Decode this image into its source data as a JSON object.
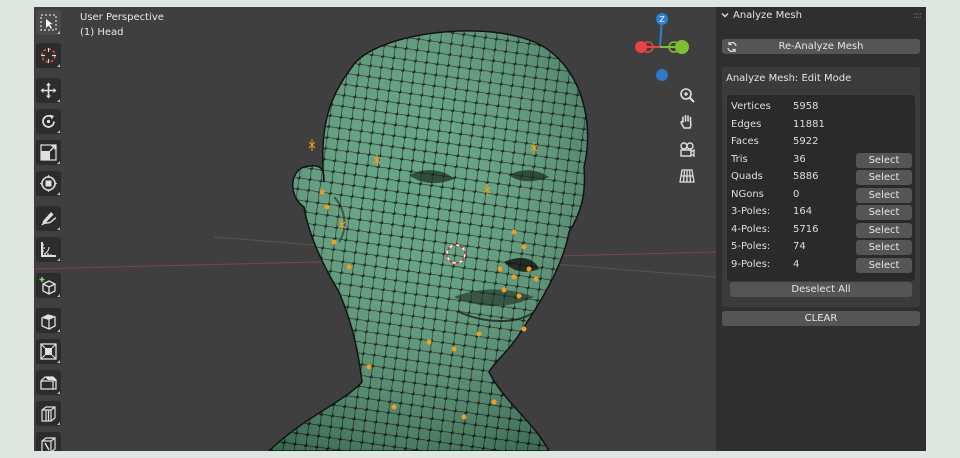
{
  "viewport": {
    "title": "User Perspective",
    "subtitle": "(1) Head",
    "gizmo": {
      "z_label": "Z",
      "y_label": "Y",
      "x_label": "X"
    }
  },
  "toolbar": {
    "tools": [
      {
        "icon": "select-box-icon",
        "active": true
      },
      {
        "icon": "cursor-icon",
        "active": false
      },
      {
        "icon": "move-icon",
        "active": false
      },
      {
        "icon": "rotate-icon",
        "active": false
      },
      {
        "icon": "scale-icon",
        "active": false
      },
      {
        "icon": "transform-icon",
        "active": false
      },
      {
        "icon": "annotate-icon",
        "active": false
      },
      {
        "icon": "measure-icon",
        "active": false
      },
      {
        "icon": "add-cube-icon",
        "active": false
      },
      {
        "icon": "extrude-icon",
        "active": false
      },
      {
        "icon": "inset-icon",
        "active": false
      },
      {
        "icon": "bevel-icon",
        "active": false
      },
      {
        "icon": "loop-cut-icon",
        "active": false
      },
      {
        "icon": "knife-icon",
        "active": false
      }
    ]
  },
  "navigation": {
    "buttons": [
      "zoom-icon",
      "hand-pan-icon",
      "camera-icon",
      "grid-view-icon"
    ]
  },
  "panel": {
    "header": "Analyze Mesh",
    "reanalyze_label": "Re-Analyze Mesh",
    "subpanel_title": "Analyze Mesh: Edit Mode",
    "select_label": "Select",
    "stats": [
      {
        "label": "Vertices",
        "value": "5958",
        "selectable": false
      },
      {
        "label": "Edges",
        "value": "11881",
        "selectable": false
      },
      {
        "label": "Faces",
        "value": "5922",
        "selectable": false
      },
      {
        "label": "Tris",
        "value": "36",
        "selectable": true
      },
      {
        "label": "Quads",
        "value": "5886",
        "selectable": true
      },
      {
        "label": "NGons",
        "value": "0",
        "selectable": true
      },
      {
        "label": "3-Poles:",
        "value": "164",
        "selectable": true
      },
      {
        "label": "4-Poles:",
        "value": "5716",
        "selectable": true
      },
      {
        "label": "5-Poles:",
        "value": "74",
        "selectable": true
      },
      {
        "label": "9-Poles:",
        "value": "4",
        "selectable": true
      }
    ],
    "deselect_label": "Deselect All",
    "clear_label": "CLEAR"
  },
  "colors": {
    "mesh": "#5a9f7c",
    "wire": "#0d1510",
    "pole_highlight": "#f0a020",
    "axis_x": "#e54545",
    "axis_y": "#7fbf30",
    "axis_z": "#2f7fd6"
  }
}
